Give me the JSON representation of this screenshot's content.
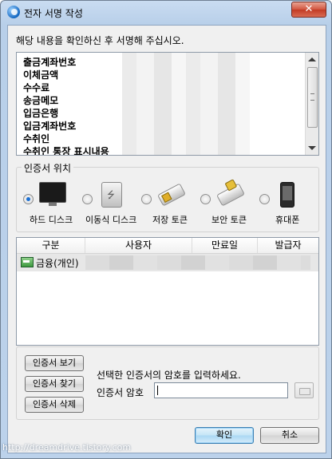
{
  "window": {
    "title": "전자 서명 작성",
    "close_glyph": "✕"
  },
  "instruction": "해당 내용을 확인하신 후 서명해 주십시오.",
  "sign_fields": [
    "출금계좌번호",
    "이체금액",
    "수수료",
    "송금메모",
    "입금은행",
    "입금계좌번호",
    "수취인",
    "수취인 통장 표시내용"
  ],
  "cert_location": {
    "label": "인증서 위치",
    "options": [
      {
        "label": "하드 디스크",
        "icon": "monitor-icon",
        "selected": true
      },
      {
        "label": "이동식 디스크",
        "icon": "removable-disk-icon",
        "selected": false
      },
      {
        "label": "저장 토큰",
        "icon": "storage-token-icon",
        "selected": false
      },
      {
        "label": "보안 토큰",
        "icon": "security-token-icon",
        "selected": false
      },
      {
        "label": "휴대폰",
        "icon": "mobile-phone-icon",
        "selected": false
      }
    ]
  },
  "cert_table": {
    "columns": [
      "구분",
      "사용자",
      "만료일",
      "발급자"
    ],
    "rows": [
      {
        "type": "금융(개인)"
      }
    ]
  },
  "buttons": {
    "view": "인증서 보기",
    "find": "인증서 찾기",
    "delete": "인증서 삭제",
    "ok": "확인",
    "cancel": "취소"
  },
  "password": {
    "hint": "선택한 인증서의 암호를 입력하세요.",
    "label": "인증서 암호",
    "value": ""
  },
  "watermark": "http://dreamdrive.tistory.com",
  "colors": {
    "title_bar": "#bcd2eb",
    "close_button": "#c94a34",
    "radio_selected": "#1a6fd3",
    "primary_button": "#c4e5f6"
  }
}
